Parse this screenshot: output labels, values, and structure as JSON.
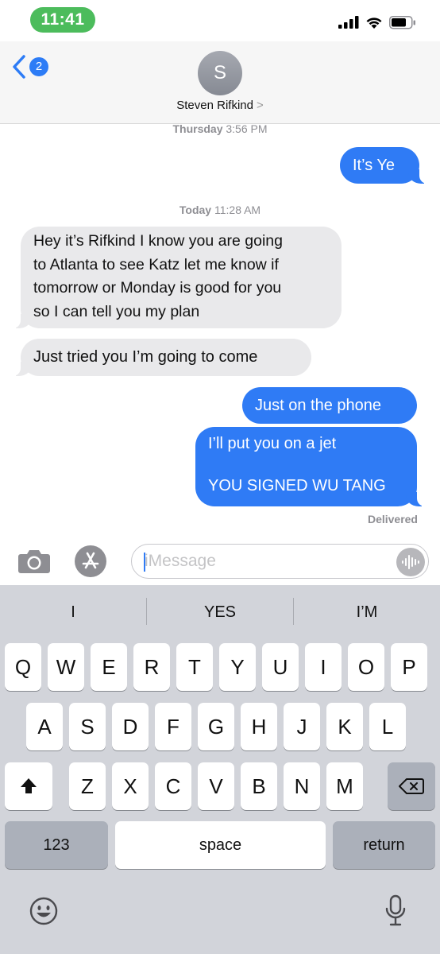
{
  "status": {
    "time": "11:41"
  },
  "header": {
    "back_badge": "2",
    "avatar_initial": "S",
    "contact_name": "Steven Rifkind",
    "chevron": ">"
  },
  "messages": {
    "ts1_day": "Thursday",
    "ts1_time": "3:56 PM",
    "out1": "It’s Ye",
    "ts2_day": "Today",
    "ts2_time": "11:28 AM",
    "in1_lines": [
      "Hey it’s Rifkind I know you are going",
      "to Atlanta to see Katz let me know if",
      "tomorrow or Monday is good for you",
      "so I can tell you my plan"
    ],
    "in2": "Just tried you I’m going to come",
    "out2": "Just on the phone",
    "out3_line1": "I’ll put you on a jet",
    "out3_line2": "YOU SIGNED WU TANG",
    "delivered": "Delivered"
  },
  "input": {
    "placeholder": "iMessage"
  },
  "keyboard": {
    "suggestions": [
      "I",
      "YES",
      "I’M"
    ],
    "row1": [
      "Q",
      "W",
      "E",
      "R",
      "T",
      "Y",
      "U",
      "I",
      "O",
      "P"
    ],
    "row2": [
      "A",
      "S",
      "D",
      "F",
      "G",
      "H",
      "J",
      "K",
      "L"
    ],
    "row3": [
      "Z",
      "X",
      "C",
      "V",
      "B",
      "N",
      "M"
    ],
    "numbers_key": "123",
    "space_key": "space",
    "return_key": "return"
  },
  "colors": {
    "outgoing": "#2f7bf5",
    "incoming": "#e9e9eb",
    "time_pill": "#4cbc5c"
  },
  "icons": [
    "signal-icon",
    "wifi-icon",
    "battery-icon",
    "back-chevron-icon",
    "camera-icon",
    "app-store-icon",
    "audio-wave-icon",
    "shift-icon",
    "backspace-icon",
    "emoji-icon",
    "microphone-icon"
  ]
}
